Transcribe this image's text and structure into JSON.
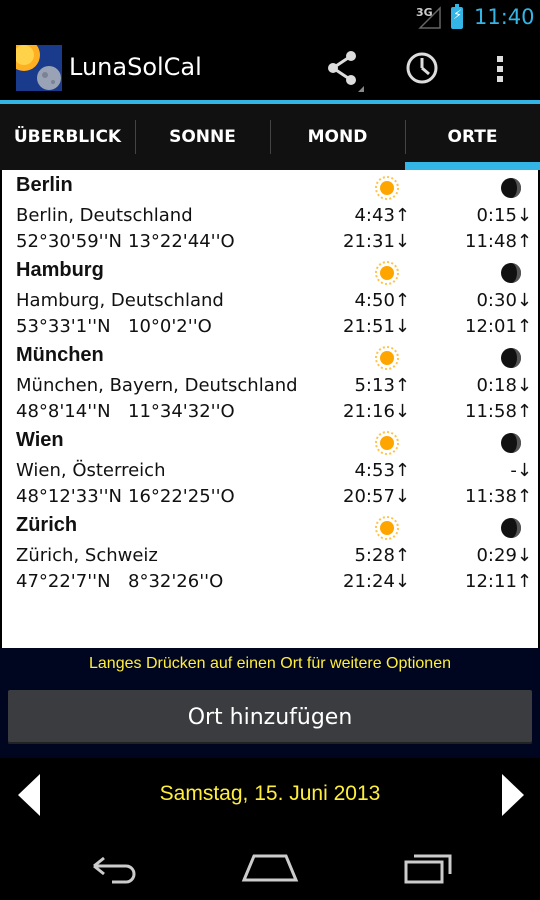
{
  "status_bar": {
    "network": "3G",
    "time": "11:40"
  },
  "app": {
    "title": "LunaSolCal"
  },
  "tabs": [
    {
      "label": "ÜBERBLICK",
      "active": false
    },
    {
      "label": "SONNE",
      "active": false
    },
    {
      "label": "MOND",
      "active": false
    },
    {
      "label": "ORTE",
      "active": true
    }
  ],
  "places": [
    {
      "name": "Berlin",
      "region": "Berlin, Deutschland",
      "lat": "52°30'59''N",
      "lon": "13°22'44''O",
      "sun_rise": "4:43↑",
      "sun_set": "21:31↓",
      "moon_1": "0:15↓",
      "moon_2": "11:48↑"
    },
    {
      "name": "Hamburg",
      "region": "Hamburg, Deutschland",
      "lat": "53°33'1''N",
      "lon": "10°0'2''O",
      "sun_rise": "4:50↑",
      "sun_set": "21:51↓",
      "moon_1": "0:30↓",
      "moon_2": "12:01↑"
    },
    {
      "name": "München",
      "region": "München, Bayern, Deutschland",
      "lat": "48°8'14''N",
      "lon": "11°34'32''O",
      "sun_rise": "5:13↑",
      "sun_set": "21:16↓",
      "moon_1": "0:18↓",
      "moon_2": "11:58↑"
    },
    {
      "name": "Wien",
      "region": "Wien, Österreich",
      "lat": "48°12'33''N",
      "lon": "16°22'25''O",
      "sun_rise": "4:53↑",
      "sun_set": "20:57↓",
      "moon_1": "-↓",
      "moon_2": "11:38↑"
    },
    {
      "name": "Zürich",
      "region": "Zürich, Schweiz",
      "lat": "47°22'7''N",
      "lon": "8°32'26''O",
      "sun_rise": "5:28↑",
      "sun_set": "21:24↓",
      "moon_1": "0:29↓",
      "moon_2": "12:11↑"
    }
  ],
  "hint": "Langes Drücken auf einen Ort für weitere Optionen",
  "add_button": "Ort hinzufügen",
  "date": "Samstag, 15. Juni 2013",
  "colors": {
    "accent": "#33b5e5",
    "highlight_text": "#ffef3b",
    "sun": "#ffa500",
    "moon": "#111111"
  }
}
